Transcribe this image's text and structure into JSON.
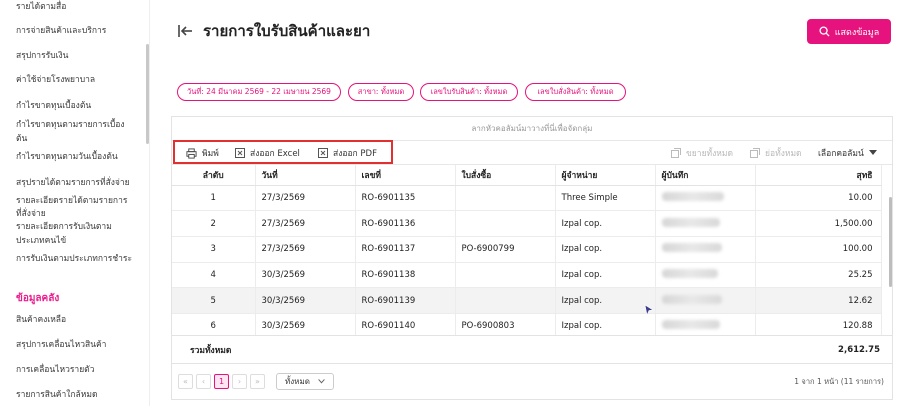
{
  "sidebar": {
    "items": [
      {
        "label": "รายได้ตามสื่อ"
      },
      {
        "label": "การจ่ายสินค้าและบริการ"
      },
      {
        "label": "สรุปการรับเงิน"
      },
      {
        "label": "ค่าใช้จ่ายโรงพยาบาล"
      },
      {
        "label": "กำไรขาดทุนเบื้องต้น"
      },
      {
        "label": "กำไรขาดทุนตามรายการเบื้อง"
      },
      {
        "label": "ต้น"
      },
      {
        "label": "กำไรขาดทุนตามวันเบื้องต้น"
      },
      {
        "label": "สรุปรายได้ตามรายการที่สั่งจ่าย"
      },
      {
        "label": "รายละเอียดรายได้ตามรายการ"
      },
      {
        "label": "ที่สั่งจ่าย"
      },
      {
        "label": "รายละเอียดการรับเงินตาม"
      },
      {
        "label": "ประเภทคนไข้"
      },
      {
        "label": "การรับเงินตามประเภทการชำระ"
      }
    ],
    "section_title": "ข้อมูลคลัง",
    "section_items": [
      {
        "label": "สินค้าคงเหลือ"
      },
      {
        "label": "สรุปการเคลื่อนไหวสินค้า"
      },
      {
        "label": "การเคลื่อนไหวรายตัว"
      },
      {
        "label": "รายการสินค้าใกล้หมด"
      }
    ]
  },
  "header": {
    "title": "รายการใบรับสินค้าและยา",
    "show_button": "แสดงข้อมูล"
  },
  "filters": [
    {
      "label": "วันที่: 24 มีนาคม 2569 - 22 เมษายน 2569"
    },
    {
      "label": "สาขา: ทั้งหมด"
    },
    {
      "label": "เลขใบรับสินค้า: ทั้งหมด"
    },
    {
      "label": "เลขใบสั่งสินค้า: ทั้งหมด"
    }
  ],
  "grid": {
    "group_panel_text": "ลากหัวคอลัมน์มาวางที่นี่เพื่อจัดกลุ่ม",
    "toolbar": {
      "print": "พิมพ์",
      "export_excel": "ส่งออก Excel",
      "export_pdf": "ส่งออก PDF",
      "expand_all": "ขยายทั้งหมด",
      "collapse_all": "ย่อทั้งหมด",
      "choose_columns": "เลือกคอลัมน์"
    },
    "columns": [
      "ลำดับ",
      "วันที่",
      "เลขที่",
      "ใบสั่งซื้อ",
      "ผู้จำหน่าย",
      "ผู้บันทึก",
      "สุทธิ"
    ],
    "rows": [
      {
        "no": "1",
        "date": "27/3/2569",
        "doc": "RO-6901135",
        "po": "",
        "vendor": "Three Simple",
        "net": "10.00"
      },
      {
        "no": "2",
        "date": "27/3/2569",
        "doc": "RO-6901136",
        "po": "",
        "vendor": "Izpal cop.",
        "net": "1,500.00"
      },
      {
        "no": "3",
        "date": "27/3/2569",
        "doc": "RO-6901137",
        "po": "PO-6900799",
        "vendor": "Izpal cop.",
        "net": "100.00"
      },
      {
        "no": "4",
        "date": "30/3/2569",
        "doc": "RO-6901138",
        "po": "",
        "vendor": "Izpal cop.",
        "net": "25.25"
      },
      {
        "no": "5",
        "date": "30/3/2569",
        "doc": "RO-6901139",
        "po": "",
        "vendor": "Izpal cop.",
        "net": "12.62"
      },
      {
        "no": "6",
        "date": "30/3/2569",
        "doc": "RO-6901140",
        "po": "PO-6900803",
        "vendor": "Izpal cop.",
        "net": "120.88"
      }
    ],
    "total_label": "รวมทั้งหมด",
    "total_value": "2,612.75"
  },
  "pager": {
    "first": "«",
    "prev": "‹",
    "page": "1",
    "next": "›",
    "last": "»",
    "page_size": "ทั้งหมด",
    "info": "1 จาก 1 หน้า (11 รายการ)"
  },
  "colors": {
    "accent": "#e6127d",
    "highlight_box": "#e03030"
  }
}
